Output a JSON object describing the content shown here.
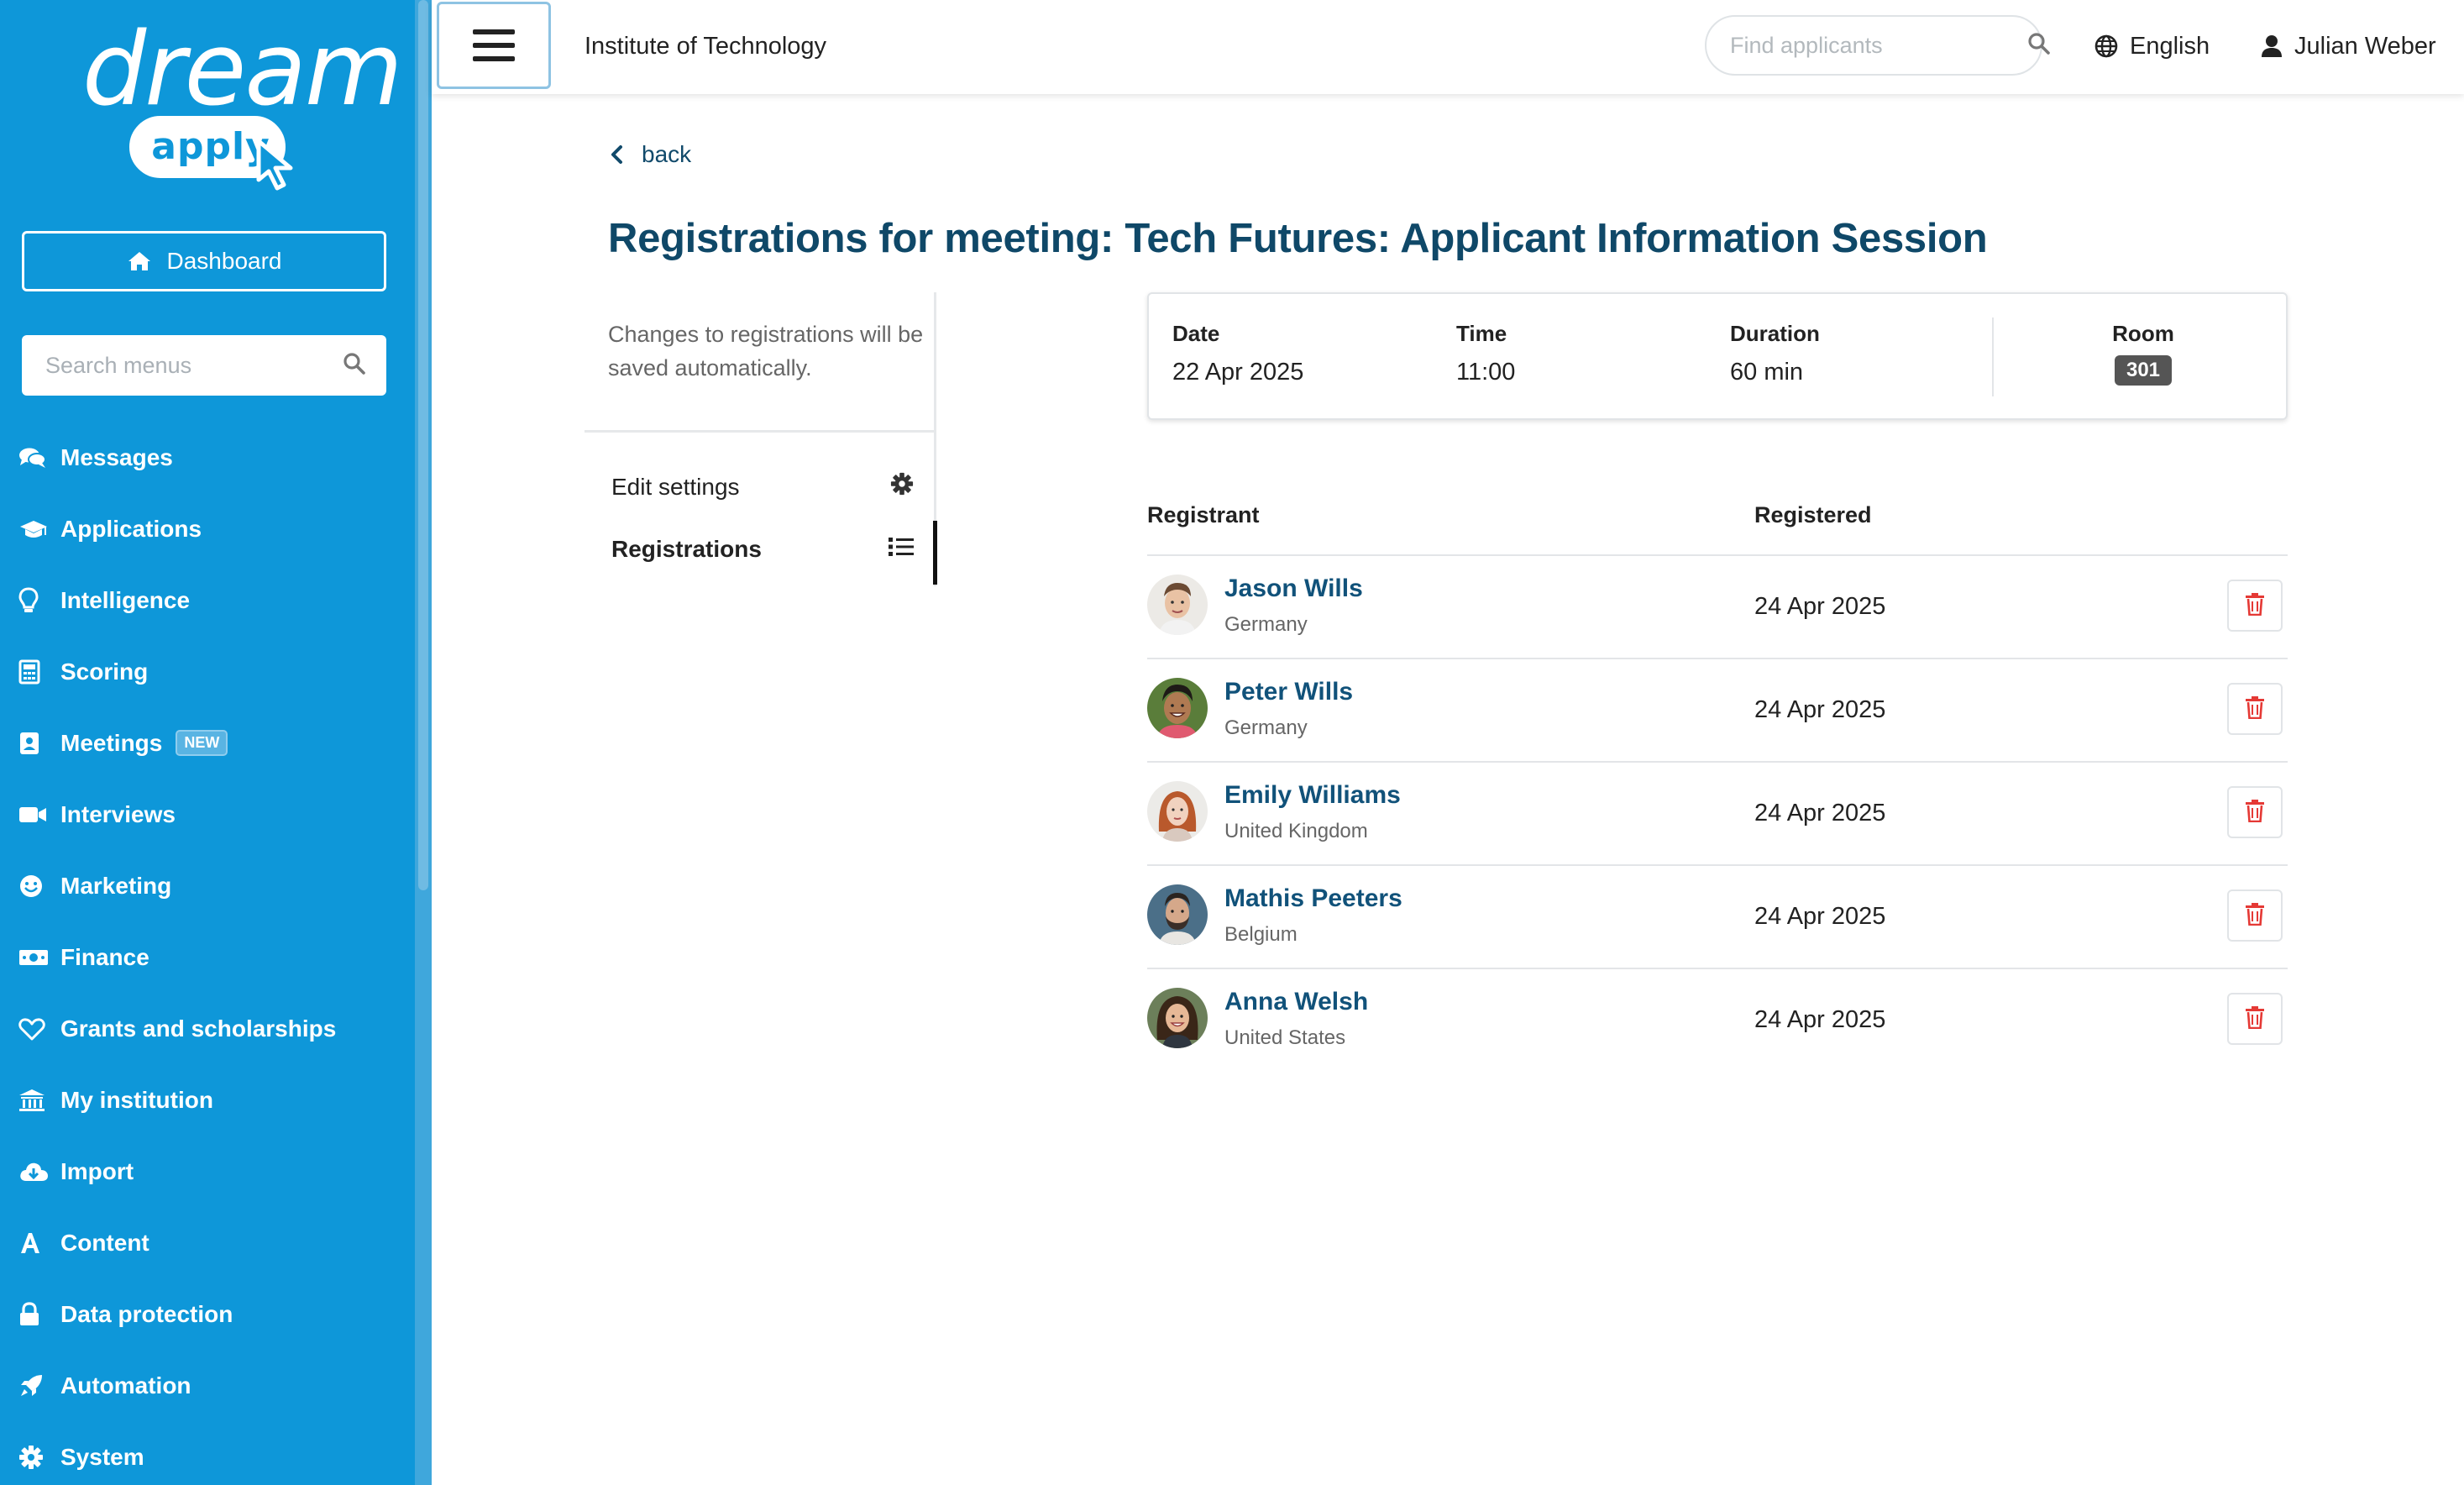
{
  "brand": {
    "word": "dream",
    "pill": "apply"
  },
  "sidebar": {
    "dashboard_label": "Dashboard",
    "search_placeholder": "Search menus",
    "items": [
      {
        "label": "Messages",
        "icon": "comments-icon"
      },
      {
        "label": "Applications",
        "icon": "graduation-cap-icon"
      },
      {
        "label": "Intelligence",
        "icon": "lightbulb-icon"
      },
      {
        "label": "Scoring",
        "icon": "calculator-icon"
      },
      {
        "label": "Meetings",
        "icon": "id-badge-icon",
        "badge": "NEW"
      },
      {
        "label": "Interviews",
        "icon": "video-icon"
      },
      {
        "label": "Marketing",
        "icon": "smile-icon"
      },
      {
        "label": "Finance",
        "icon": "money-icon"
      },
      {
        "label": "Grants and scholarships",
        "icon": "heart-icon"
      },
      {
        "label": "My institution",
        "icon": "institution-icon"
      },
      {
        "label": "Import",
        "icon": "cloud-download-icon"
      },
      {
        "label": "Content",
        "icon": "font-icon"
      },
      {
        "label": "Data protection",
        "icon": "lock-icon"
      },
      {
        "label": "Automation",
        "icon": "rocket-icon"
      },
      {
        "label": "System",
        "icon": "gear-icon"
      }
    ]
  },
  "topbar": {
    "institution": "Institute of Technology",
    "search_placeholder": "Find applicants",
    "language": "English",
    "user": "Julian Weber"
  },
  "page": {
    "back_label": "back",
    "title": "Registrations for meeting: Tech Futures: Applicant Information Session",
    "hint": "Changes to registrations will be saved automatically.",
    "nav": [
      {
        "label": "Edit settings",
        "icon": "gear-icon",
        "active": false
      },
      {
        "label": "Registrations",
        "icon": "list-icon",
        "active": true
      }
    ]
  },
  "meeting": {
    "date_label": "Date",
    "date": "22 Apr 2025",
    "time_label": "Time",
    "time": "11:00",
    "duration_label": "Duration",
    "duration": "60 min",
    "room_label": "Room",
    "room": "301"
  },
  "registrations": {
    "headers": {
      "registrant": "Registrant",
      "registered": "Registered"
    },
    "rows": [
      {
        "name": "Jason Wills",
        "country": "Germany",
        "registered": "24 Apr 2025"
      },
      {
        "name": "Peter Wills",
        "country": "Germany",
        "registered": "24 Apr 2025"
      },
      {
        "name": "Emily Williams",
        "country": "United Kingdom",
        "registered": "24 Apr 2025"
      },
      {
        "name": "Mathis Peeters",
        "country": "Belgium",
        "registered": "24 Apr 2025"
      },
      {
        "name": "Anna Welsh",
        "country": "United States",
        "registered": "24 Apr 2025"
      }
    ]
  },
  "colors": {
    "sidebar": "#0e97d9",
    "title": "#0f4868",
    "link": "#11527a",
    "delete": "#e53935"
  }
}
